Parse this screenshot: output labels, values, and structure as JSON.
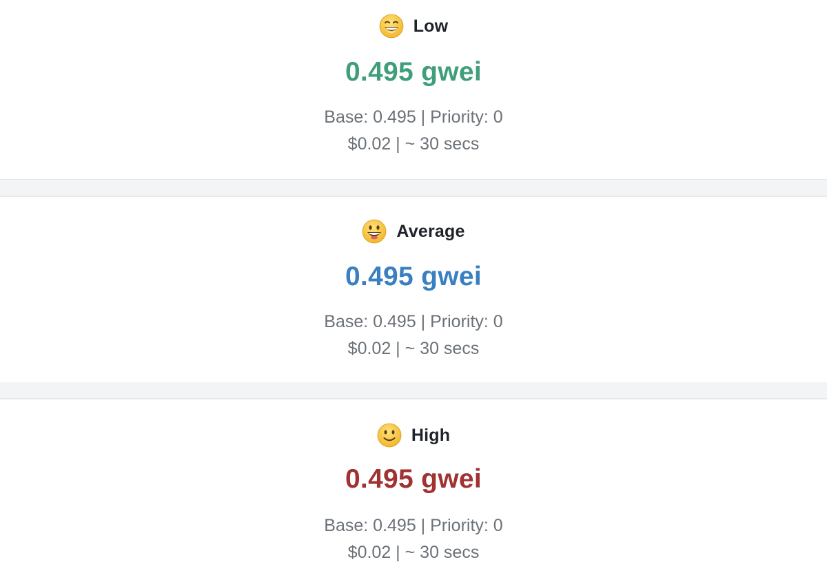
{
  "levels": [
    {
      "label": "Low",
      "icon": "grinning-squinting-face-icon",
      "price": "0.495 gwei",
      "price_color": "#3f9f7a",
      "breakdown": "Base: 0.495 | Priority: 0",
      "cost_time": "$0.02 | ~ 30 secs"
    },
    {
      "label": "Average",
      "icon": "grinning-face-big-eyes-icon",
      "price": "0.495 gwei",
      "price_color": "#3a80c0",
      "breakdown": "Base: 0.495 | Priority: 0",
      "cost_time": "$0.02 | ~ 30 secs"
    },
    {
      "label": "High",
      "icon": "slightly-smiling-face-icon",
      "price": "0.495 gwei",
      "price_color": "#a03232",
      "breakdown": "Base: 0.495 | Priority: 0",
      "cost_time": "$0.02 | ~ 30 secs"
    }
  ]
}
